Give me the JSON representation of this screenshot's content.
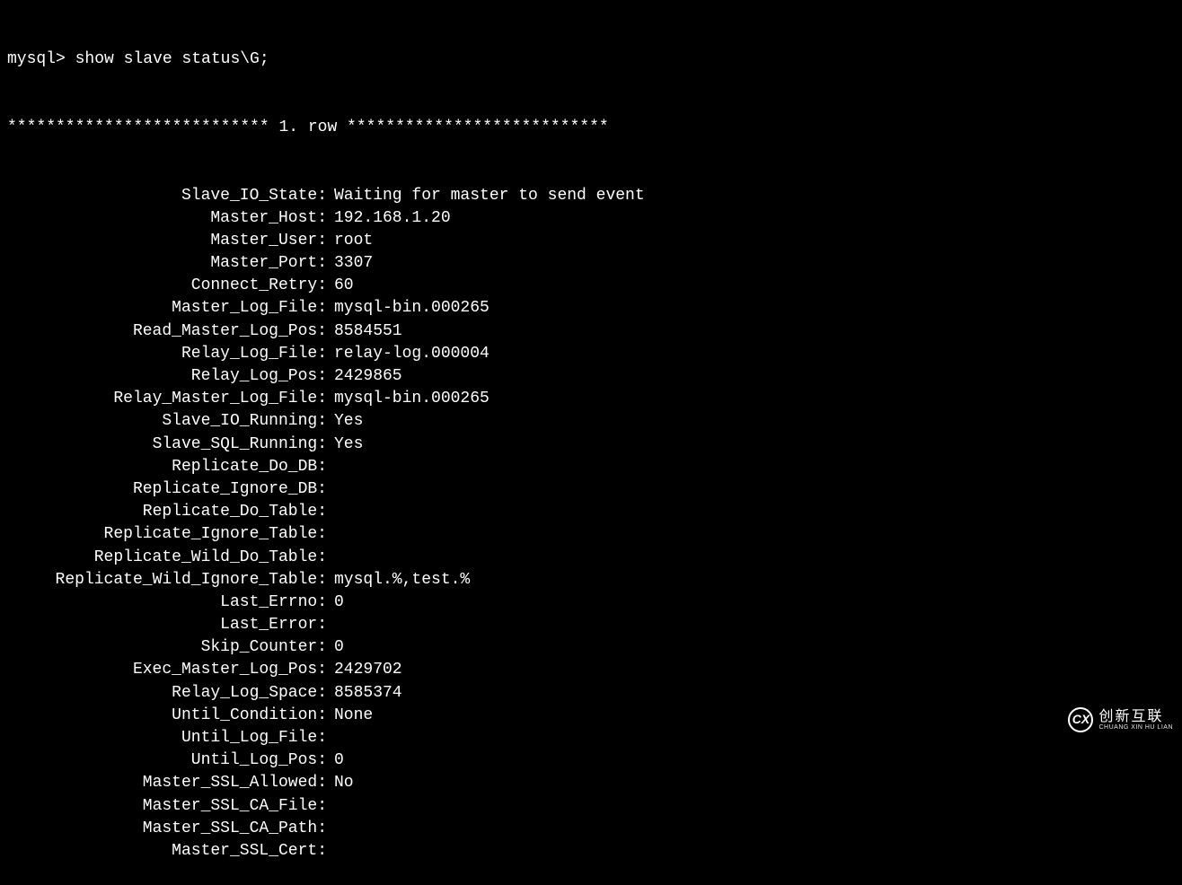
{
  "prompt": "mysql> show slave status\\G;",
  "row_header": "*************************** 1. row ***************************",
  "fields": [
    {
      "key": "Slave_IO_State",
      "value": "Waiting for master to send event"
    },
    {
      "key": "Master_Host",
      "value": "192.168.1.20"
    },
    {
      "key": "Master_User",
      "value": "root"
    },
    {
      "key": "Master_Port",
      "value": "3307"
    },
    {
      "key": "Connect_Retry",
      "value": "60"
    },
    {
      "key": "Master_Log_File",
      "value": "mysql-bin.000265"
    },
    {
      "key": "Read_Master_Log_Pos",
      "value": "8584551"
    },
    {
      "key": "Relay_Log_File",
      "value": "relay-log.000004"
    },
    {
      "key": "Relay_Log_Pos",
      "value": "2429865"
    },
    {
      "key": "Relay_Master_Log_File",
      "value": "mysql-bin.000265"
    },
    {
      "key": "Slave_IO_Running",
      "value": "Yes"
    },
    {
      "key": "Slave_SQL_Running",
      "value": "Yes"
    },
    {
      "key": "Replicate_Do_DB",
      "value": ""
    },
    {
      "key": "Replicate_Ignore_DB",
      "value": ""
    },
    {
      "key": "Replicate_Do_Table",
      "value": ""
    },
    {
      "key": "Replicate_Ignore_Table",
      "value": ""
    },
    {
      "key": "Replicate_Wild_Do_Table",
      "value": ""
    },
    {
      "key": "Replicate_Wild_Ignore_Table",
      "value": "mysql.%,test.%"
    },
    {
      "key": "Last_Errno",
      "value": "0"
    },
    {
      "key": "Last_Error",
      "value": ""
    },
    {
      "key": "Skip_Counter",
      "value": "0"
    },
    {
      "key": "Exec_Master_Log_Pos",
      "value": "2429702"
    },
    {
      "key": "Relay_Log_Space",
      "value": "8585374"
    },
    {
      "key": "Until_Condition",
      "value": "None"
    },
    {
      "key": "Until_Log_File",
      "value": ""
    },
    {
      "key": "Until_Log_Pos",
      "value": "0"
    },
    {
      "key": "Master_SSL_Allowed",
      "value": "No"
    },
    {
      "key": "Master_SSL_CA_File",
      "value": ""
    },
    {
      "key": "Master_SSL_CA_Path",
      "value": ""
    },
    {
      "key": "Master_SSL_Cert",
      "value": ""
    }
  ],
  "watermark": {
    "logo_text": "CX",
    "cn": "创新互联",
    "en": "CHUANG XIN HU LIAN"
  }
}
